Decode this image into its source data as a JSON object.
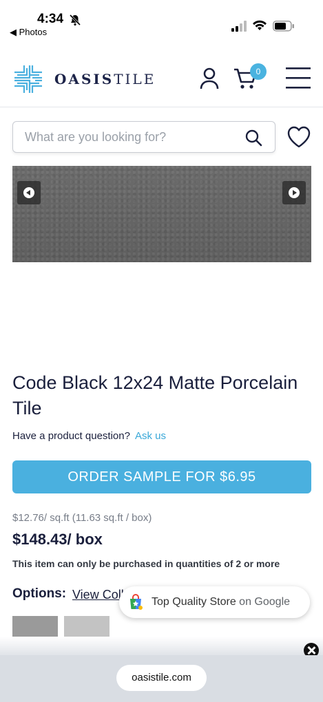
{
  "status_bar": {
    "time": "4:34",
    "back_label": "◀ Photos",
    "icons": [
      "bell-slash-icon",
      "signal-icon",
      "wifi-icon",
      "battery-icon"
    ]
  },
  "header": {
    "logo_bold": "OASIS",
    "logo_light": "TILE",
    "cart_count": "0",
    "icons": [
      "account-icon",
      "cart-icon",
      "menu-icon"
    ]
  },
  "search": {
    "placeholder": "What are you looking for?",
    "value": ""
  },
  "product": {
    "title": "Code Black 12x24 Matte Porcelain Tile",
    "question_label": "Have a product question?",
    "ask_label": "Ask us",
    "order_sample_label": "ORDER SAMPLE FOR $6.95",
    "price_sqft": "$12.76/ sq.ft (11.63 sq.ft / box)",
    "price_box": "$148.43/ box",
    "qty_note": "This item can only be purchased in quantities of 2 or more",
    "options_label": "Options:",
    "view_collection_label": "View Coll"
  },
  "google_badge": {
    "store_text": "Top Quality Store",
    "on_google": " on Google"
  },
  "safari": {
    "url": "oasistile.com"
  },
  "colors": {
    "accent": "#4ab0df",
    "navy": "#1a1f3c"
  }
}
